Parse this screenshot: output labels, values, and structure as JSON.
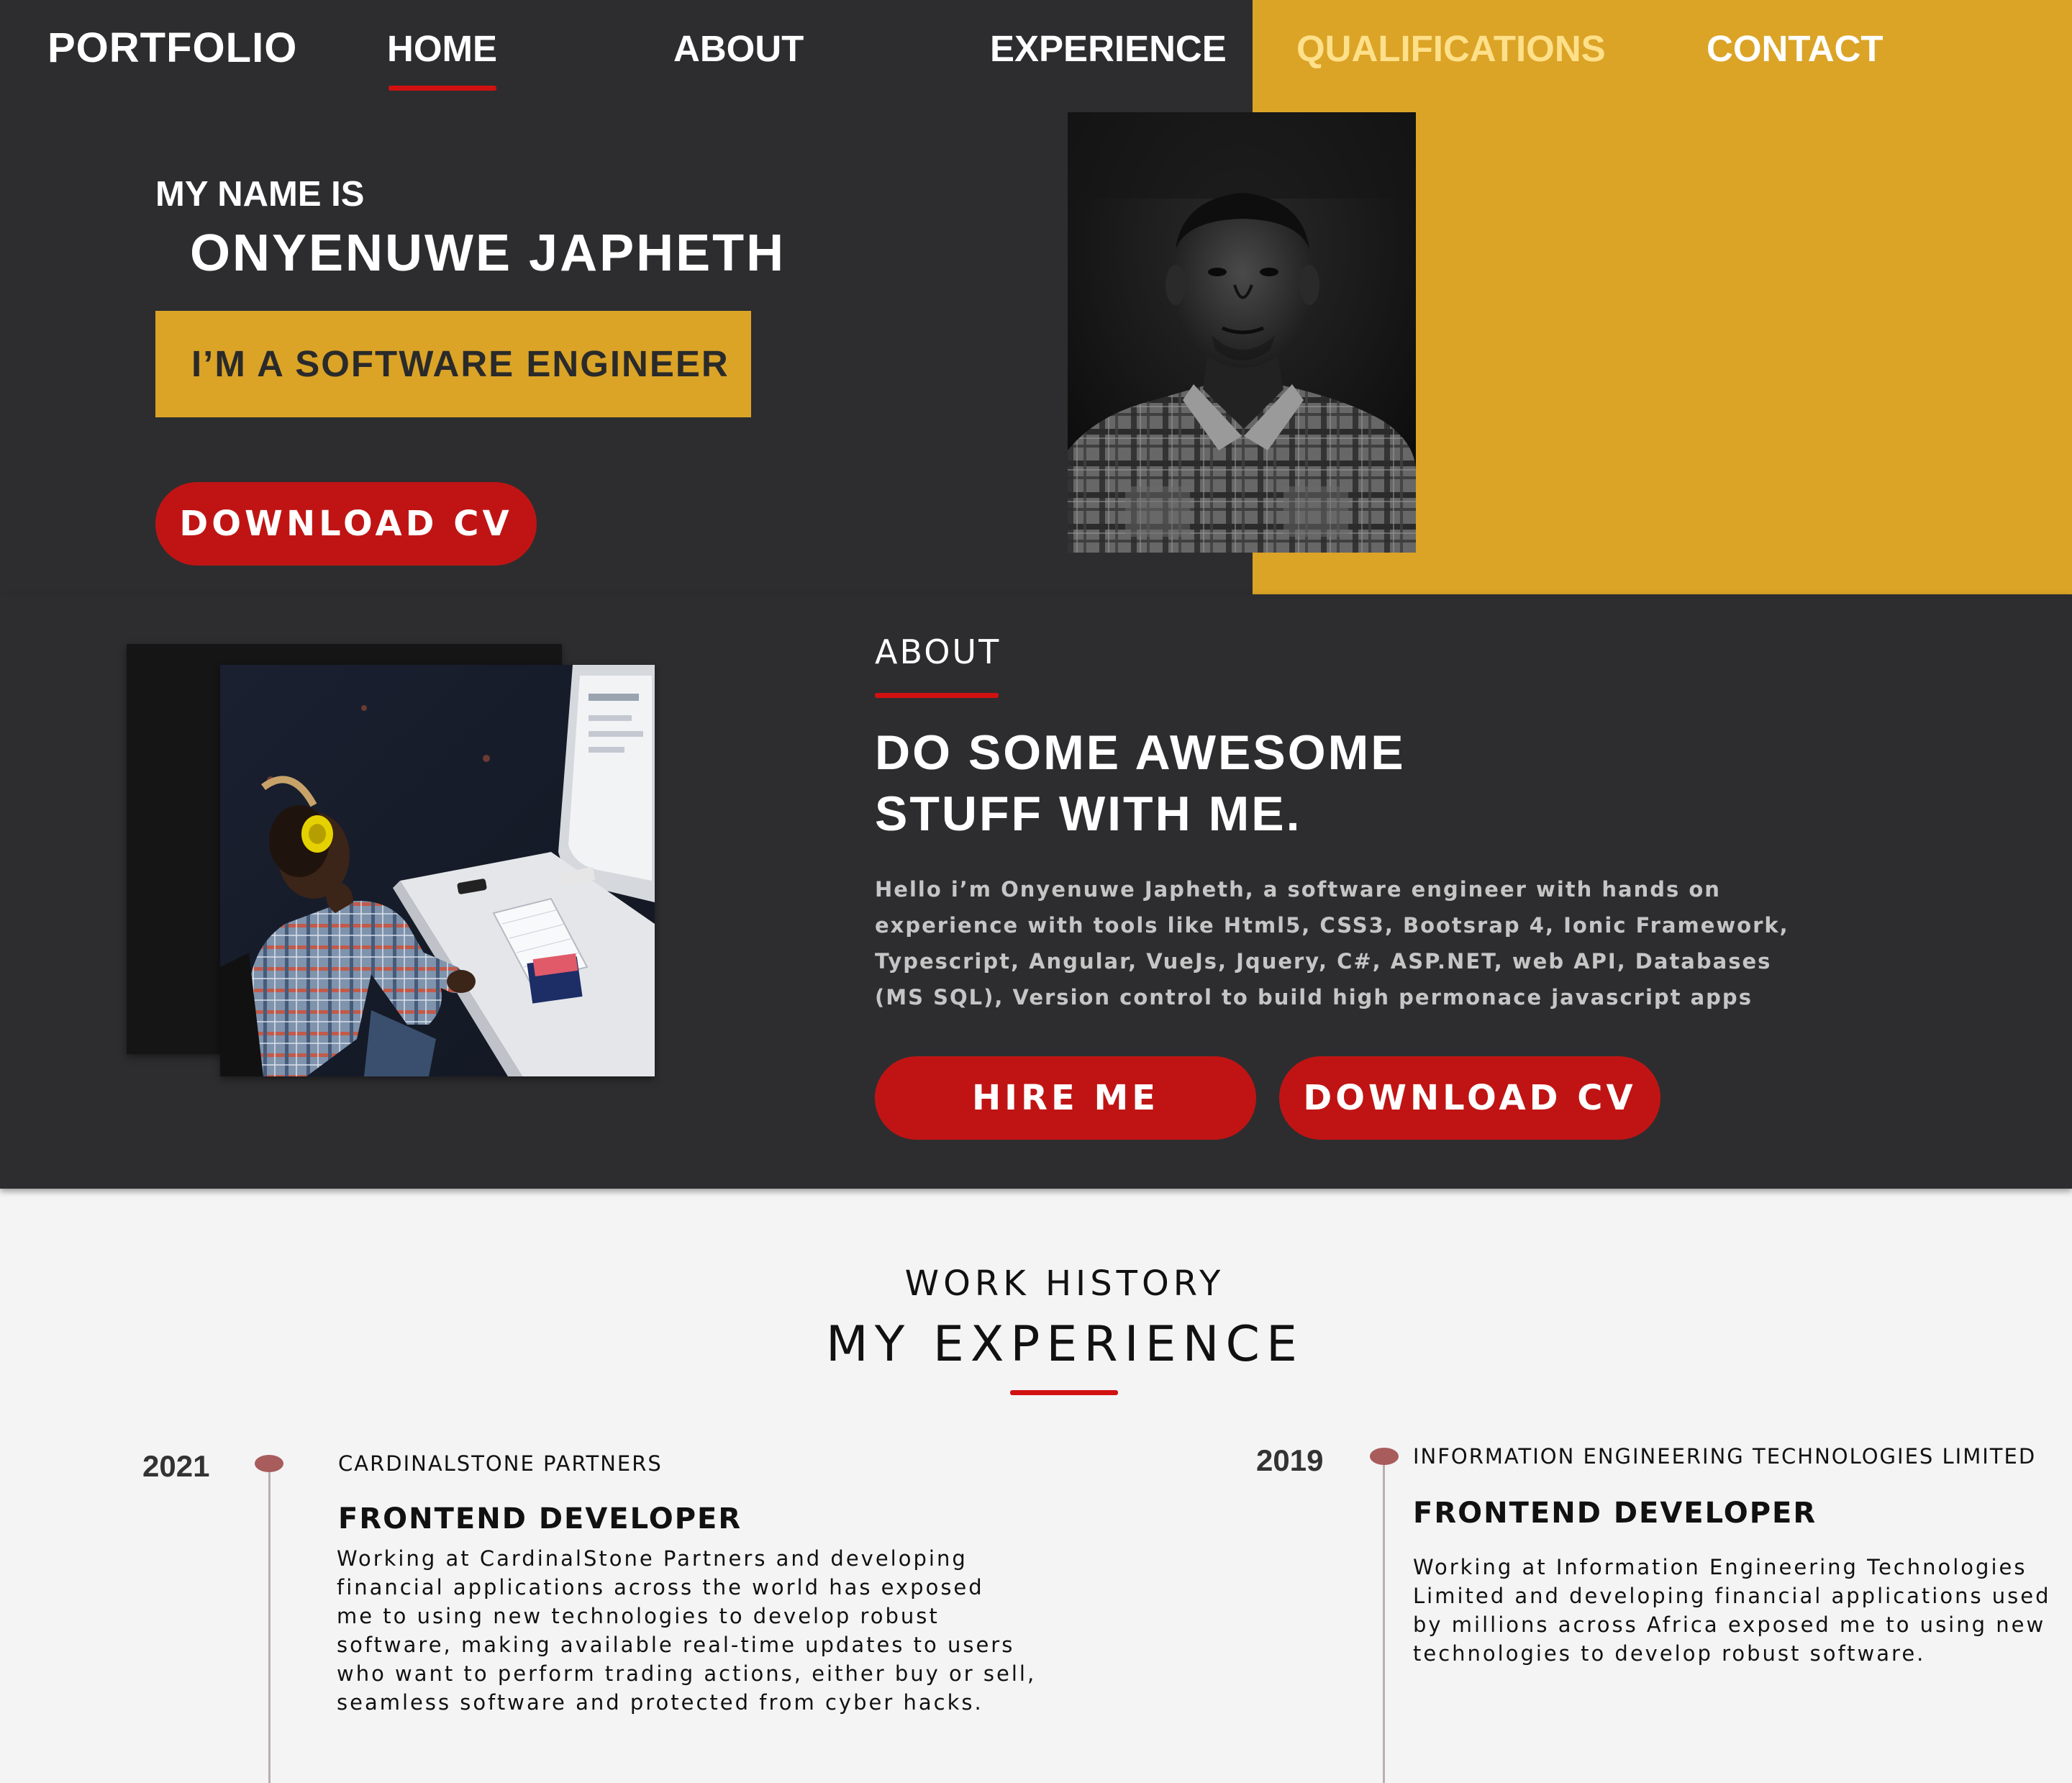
{
  "brand": "PORTFOLIO",
  "nav": {
    "items": [
      {
        "label": "HOME",
        "active": true
      },
      {
        "label": "ABOUT"
      },
      {
        "label": "EXPERIENCE"
      },
      {
        "label": "QUALIFICATIONS",
        "highlight": "#FFE08A"
      },
      {
        "label": "CONTACT"
      }
    ]
  },
  "hero": {
    "intro": "MY NAME IS",
    "name": "ONYENUWE JAPHETH",
    "role": "I’M A SOFTWARE ENGINEER",
    "download_label": "DOWNLOAD CV"
  },
  "about": {
    "label": "ABOUT",
    "heading_lines": [
      "DO SOME AWESOME",
      "STUFF WITH ME."
    ],
    "body_lines": [
      "Hello i’m Onyenuwe Japheth, a software engineer with hands on",
      "experience with tools like Html5, CSS3, Bootsrap 4, Ionic Framework,",
      "Typescript, Angular, VueJs, Jquery, C#, ASP.NET, web API, Databases",
      "(MS SQL), Version control to build high permonace javascript apps"
    ],
    "hire_label": "HIRE ME",
    "download_label": "DOWNLOAD CV"
  },
  "experience": {
    "kicker": "WORK HISTORY",
    "title": "MY EXPERIENCE",
    "items": [
      {
        "year": "2021",
        "company": "CARDINALSTONE PARTNERS",
        "title": "FRONTEND DEVELOPER",
        "lines": [
          "Working at CardinalStone Partners and developing",
          "financial applications across the world has exposed",
          "me to using new technologies to develop robust",
          "software, making available real-time updates to users",
          "who want to perform trading actions, either buy or sell,",
          "seamless software and protected from cyber hacks."
        ]
      },
      {
        "year": "2019",
        "company": "INFORMATION ENGINEERING TECHNOLOGIES LIMITED",
        "title": "FRONTEND DEVELOPER",
        "lines": [
          "Working at Information Engineering Technologies",
          "Limited and developing financial applications used",
          "by millions across Africa exposed me to using new",
          "technologies to develop robust software."
        ]
      }
    ]
  },
  "colors": {
    "dark": "#2D2D2F",
    "gold": "#DBA427",
    "accent_red": "#C01414",
    "light_bg": "#F4F4F4"
  }
}
